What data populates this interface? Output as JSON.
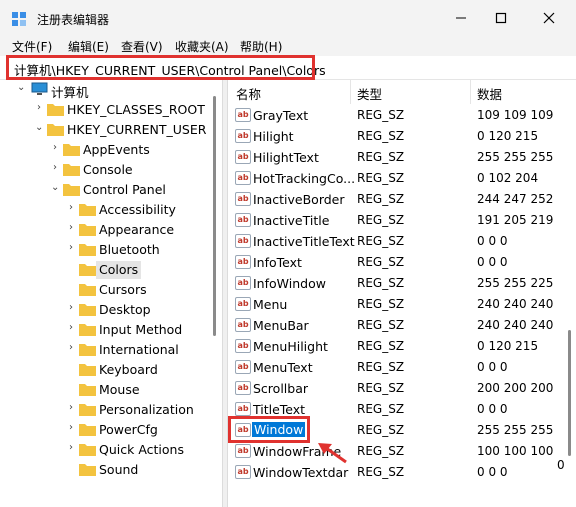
{
  "window": {
    "title": "注册表编辑器",
    "minimize_glyph": "—",
    "maximize_glyph": "☐",
    "close_glyph": "✕"
  },
  "menu": [
    "文件(F)",
    "编辑(E)",
    "查看(V)",
    "收藏夹(A)",
    "帮助(H)"
  ],
  "address": {
    "path": "计算机\\HKEY_CURRENT_USER\\Control Panel\\Colors"
  },
  "tree": {
    "items": [
      {
        "label": "计算机",
        "chev": "⌄"
      },
      {
        "label": "HKEY_CLASSES_ROOT",
        "chev": "›"
      },
      {
        "label": "HKEY_CURRENT_USER",
        "chev": "⌄"
      },
      {
        "label": "AppEvents",
        "chev": "›"
      },
      {
        "label": "Console",
        "chev": "›"
      },
      {
        "label": "Control Panel",
        "chev": "⌄"
      },
      {
        "label": "Accessibility",
        "chev": "›"
      },
      {
        "label": "Appearance",
        "chev": "›"
      },
      {
        "label": "Bluetooth",
        "chev": "›"
      },
      {
        "label": "Colors",
        "chev": ""
      },
      {
        "label": "Cursors",
        "chev": ""
      },
      {
        "label": "Desktop",
        "chev": "›"
      },
      {
        "label": "Input Method",
        "chev": "›"
      },
      {
        "label": "International",
        "chev": "›"
      },
      {
        "label": "Keyboard",
        "chev": ""
      },
      {
        "label": "Mouse",
        "chev": ""
      },
      {
        "label": "Personalization",
        "chev": "›"
      },
      {
        "label": "PowerCfg",
        "chev": "›"
      },
      {
        "label": "Quick Actions",
        "chev": "›"
      },
      {
        "label": "Sound",
        "chev": ""
      }
    ]
  },
  "list": {
    "headers": {
      "name": "名称",
      "type": "类型",
      "data": "数据"
    },
    "icon_text": "ab",
    "rows": [
      {
        "name": "GrayText",
        "type": "REG_SZ",
        "data": "109 109 109"
      },
      {
        "name": "Hilight",
        "type": "REG_SZ",
        "data": "0 120 215"
      },
      {
        "name": "HilightText",
        "type": "REG_SZ",
        "data": "255 255 255"
      },
      {
        "name": "HotTrackingCo...",
        "type": "REG_SZ",
        "data": "0 102 204"
      },
      {
        "name": "InactiveBorder",
        "type": "REG_SZ",
        "data": "244 247 252"
      },
      {
        "name": "InactiveTitle",
        "type": "REG_SZ",
        "data": "191 205 219"
      },
      {
        "name": "InactiveTitleText",
        "type": "REG_SZ",
        "data": "0 0 0"
      },
      {
        "name": "InfoText",
        "type": "REG_SZ",
        "data": "0 0 0"
      },
      {
        "name": "InfoWindow",
        "type": "REG_SZ",
        "data": "255 255 225"
      },
      {
        "name": "Menu",
        "type": "REG_SZ",
        "data": "240 240 240"
      },
      {
        "name": "MenuBar",
        "type": "REG_SZ",
        "data": "240 240 240"
      },
      {
        "name": "MenuHilight",
        "type": "REG_SZ",
        "data": "0 120 215"
      },
      {
        "name": "MenuText",
        "type": "REG_SZ",
        "data": "0 0 0"
      },
      {
        "name": "Scrollbar",
        "type": "REG_SZ",
        "data": "200 200 200"
      },
      {
        "name": "TitleText",
        "type": "REG_SZ",
        "data": "0 0 0"
      },
      {
        "name": "Window",
        "type": "REG_SZ",
        "data": "255 255 255"
      },
      {
        "name": "WindowFrame",
        "type": "REG_SZ",
        "data": "100 100 100"
      },
      {
        "name": "WindowTextdar",
        "type": "REG_SZ",
        "data": "0 0 0"
      }
    ],
    "overflow_digit": "0"
  },
  "colors": {
    "highlight_box": "#e0322f",
    "selection": "#0078d7",
    "folder": "#f3c33f"
  }
}
